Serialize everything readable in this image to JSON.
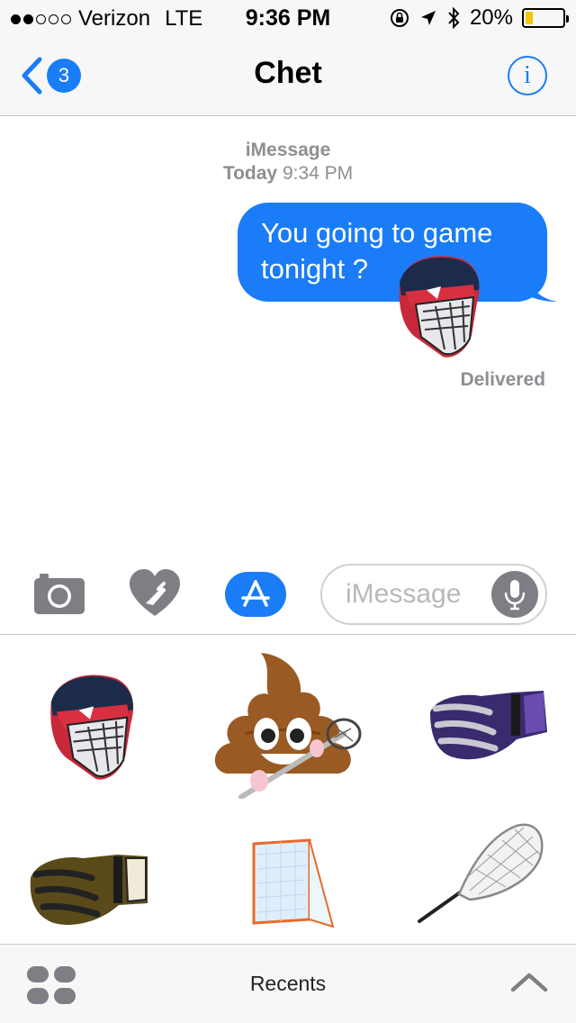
{
  "status_bar": {
    "signal_bars_filled": 2,
    "signal_bars_total": 5,
    "carrier": "Verizon",
    "network": "LTE",
    "time": "9:36 PM",
    "battery_percent": "20%",
    "battery_level": 0.2,
    "icons": [
      "rotation-lock-icon",
      "location-arrow-icon",
      "bluetooth-icon",
      "battery-icon"
    ]
  },
  "nav": {
    "back_badge": "3",
    "title": "Chet",
    "info_icon": "info-icon"
  },
  "conversation": {
    "service": "iMessage",
    "day": "Today",
    "time": "9:34 PM",
    "message": "You going to game tonight ?",
    "sticker": "lacrosse-helmet-sticker",
    "status": "Delivered"
  },
  "input": {
    "camera_icon": "camera-icon",
    "digital_touch_icon": "digital-touch-heart-icon",
    "app_store_icon": "app-store-icon",
    "placeholder": "iMessage",
    "mic_icon": "microphone-icon"
  },
  "drawer": {
    "stickers": [
      "lacrosse-helmet-sticker",
      "poop-emoji-lacrosse-stick-sticker",
      "purple-lacrosse-glove-sticker",
      "gold-lacrosse-glove-sticker",
      "lacrosse-goal-sticker",
      "lacrosse-stick-head-sticker"
    ]
  },
  "bottom_bar": {
    "apps_icon": "app-drawer-icon",
    "label": "Recents",
    "expand_icon": "chevron-up-icon"
  },
  "colors": {
    "accent": "#1a7cf7",
    "bar_background": "#f7f7f7",
    "meta_text": "#8e8e93"
  }
}
